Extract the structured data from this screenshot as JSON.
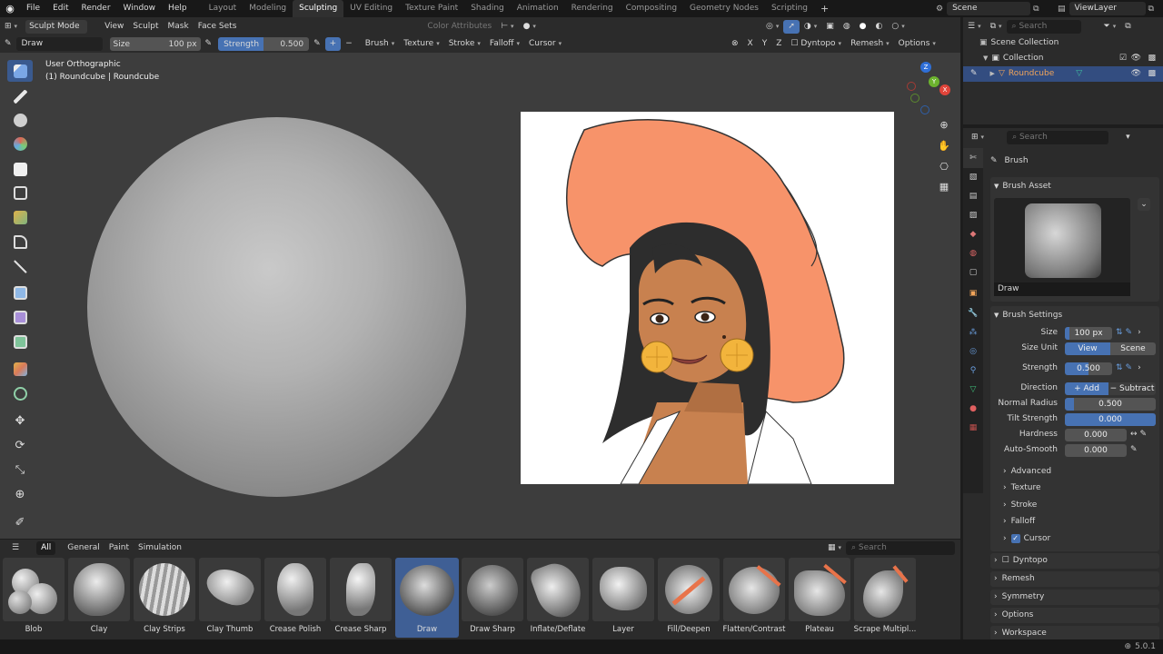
{
  "app_menu": [
    "File",
    "Edit",
    "Render",
    "Window",
    "Help"
  ],
  "workspaces": [
    {
      "label": "Layout",
      "active": false
    },
    {
      "label": "Modeling",
      "active": false
    },
    {
      "label": "Sculpting",
      "active": true
    },
    {
      "label": "UV Editing",
      "active": false
    },
    {
      "label": "Texture Paint",
      "active": false
    },
    {
      "label": "Shading",
      "active": false
    },
    {
      "label": "Animation",
      "active": false
    },
    {
      "label": "Rendering",
      "active": false
    },
    {
      "label": "Compositing",
      "active": false
    },
    {
      "label": "Geometry Nodes",
      "active": false
    },
    {
      "label": "Scripting",
      "active": false
    }
  ],
  "add_workspace": "+",
  "scene": {
    "label": "Scene",
    "view_layer": "ViewLayer"
  },
  "viewport_header": {
    "mode": "Sculpt Mode",
    "menus": [
      "View",
      "Sculpt",
      "Mask",
      "Face Sets"
    ],
    "color_attributes": "Color Attributes"
  },
  "tool_header": {
    "brush_name": "Draw",
    "size_label": "Size",
    "size_value": "100 px",
    "strength_label": "Strength",
    "strength_value": "0.500",
    "plus": "+",
    "minus": "−",
    "menus": [
      "Brush",
      "Texture",
      "Stroke",
      "Falloff",
      "Cursor"
    ],
    "axes": [
      "X",
      "Y",
      "Z"
    ],
    "dyntopo": "Dyntopo",
    "remesh": "Remesh",
    "options": "Options"
  },
  "viewport": {
    "view_name": "User Orthographic",
    "object_info": "(1) Roundcube | Roundcube"
  },
  "gizmo": {
    "x": "X",
    "y": "Y",
    "z": "Z"
  },
  "outliner": {
    "search_placeholder": "Search",
    "root": "Scene Collection",
    "collection": "Collection",
    "object": "Roundcube"
  },
  "properties": {
    "search_placeholder": "Search",
    "context_title": "Brush",
    "brush_asset_panel": "Brush Asset",
    "brush_asset_name": "Draw",
    "brush_settings_panel": "Brush Settings",
    "size_label": "Size",
    "size_value": "100 px",
    "size_unit_label": "Size Unit",
    "size_unit_view": "View",
    "size_unit_scene": "Scene",
    "strength_label": "Strength",
    "strength_value": "0.500",
    "direction_label": "Direction",
    "direction_add": "Add",
    "direction_subtract": "Subtract",
    "normal_radius_label": "Normal Radius",
    "normal_radius_value": "0.500",
    "normal_radius_fill": 0.1,
    "tilt_strength_label": "Tilt Strength",
    "tilt_strength_value": "0.000",
    "tilt_strength_fill": 1.0,
    "hardness_label": "Hardness",
    "hardness_value": "0.000",
    "auto_smooth_label": "Auto-Smooth",
    "auto_smooth_value": "0.000",
    "subpanels": [
      "Advanced",
      "Texture",
      "Stroke",
      "Falloff",
      "Cursor"
    ],
    "panels": [
      "Dyntopo",
      "Remesh",
      "Symmetry",
      "Options",
      "Workspace"
    ]
  },
  "asset_shelf": {
    "tabs": [
      {
        "label": "All",
        "active": true
      },
      {
        "label": "General",
        "active": false
      },
      {
        "label": "Paint",
        "active": false
      },
      {
        "label": "Simulation",
        "active": false
      }
    ],
    "search_placeholder": "Search",
    "brushes": [
      {
        "label": "Blob",
        "selected": false
      },
      {
        "label": "Clay",
        "selected": false
      },
      {
        "label": "Clay Strips",
        "selected": false
      },
      {
        "label": "Clay Thumb",
        "selected": false
      },
      {
        "label": "Crease Polish",
        "selected": false
      },
      {
        "label": "Crease Sharp",
        "selected": false
      },
      {
        "label": "Draw",
        "selected": true
      },
      {
        "label": "Draw Sharp",
        "selected": false
      },
      {
        "label": "Inflate/Deflate",
        "selected": false
      },
      {
        "label": "Layer",
        "selected": false
      },
      {
        "label": "Fill/Deepen",
        "selected": false
      },
      {
        "label": "Flatten/Contrast",
        "selected": false
      },
      {
        "label": "Plateau",
        "selected": false
      },
      {
        "label": "Scrape Multipl...",
        "selected": false
      }
    ]
  },
  "statusbar": {
    "version": "5.0.1"
  },
  "colors": {
    "accent": "#4772b3",
    "hat": "#f7936a",
    "skin": "#c8814f",
    "hair": "#2d2d2d",
    "earring": "#f2b43c"
  }
}
